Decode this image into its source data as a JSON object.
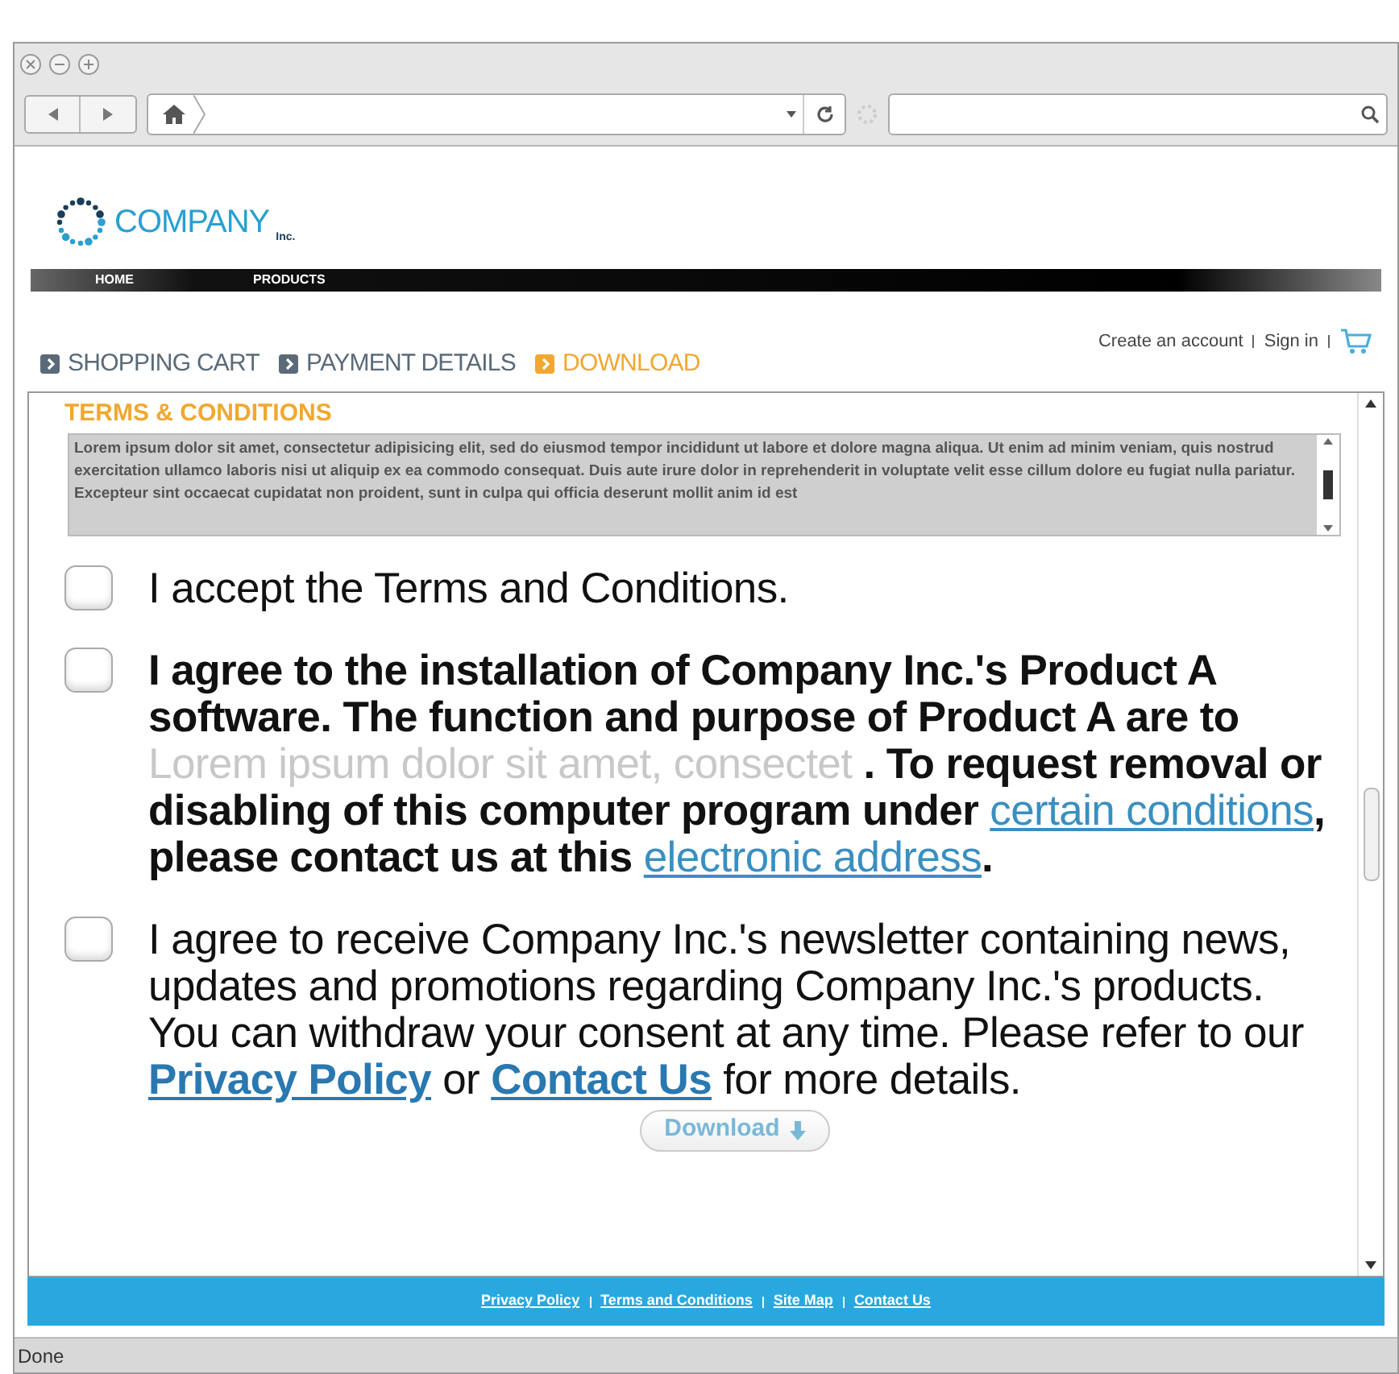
{
  "browser": {
    "status": "Done"
  },
  "site": {
    "logo": "COMPANY",
    "logo_suffix": "Inc.",
    "nav": [
      {
        "label": "HOME"
      },
      {
        "label": "PRODUCTS"
      }
    ],
    "steps": [
      {
        "label": "SHOPPING CART",
        "selected": false
      },
      {
        "label": "PAYMENT DETAILS",
        "selected": false
      },
      {
        "label": "DOWNLOAD",
        "selected": true
      }
    ],
    "account_links": [
      "Create an account",
      "Sign in"
    ]
  },
  "terms": {
    "title": "TERMS & CONDITIONS",
    "text": "Lorem ipsum dolor sit amet, consectetur adipisicing elit, sed do eiusmod tempor incididunt ut labore et dolore magna aliqua. Ut enim ad minim veniam, quis nostrud exercitation ullamco laboris nisi ut aliquip ex ea commodo consequat. Duis aute irure dolor in reprehenderit in voluptate velit esse cillum dolore eu fugiat nulla pariatur. Excepteur sint occaecat cupidatat non proident, sunt in culpa qui officia deserunt mollit anim id est"
  },
  "consents": [
    {
      "checked": false,
      "bold": false,
      "parts": [
        {
          "kind": "text",
          "text": "I accept the Terms and Conditions."
        }
      ]
    },
    {
      "checked": false,
      "bold": true,
      "parts": [
        {
          "kind": "text",
          "text": "I agree to the installation of Company Inc.'s Product A software. The function and purpose of Product A are to "
        },
        {
          "kind": "blurred",
          "text": "Lorem ipsum dolor sit amet, consectet"
        },
        {
          "kind": "text",
          "text": " . To request removal or disabling of this computer program under "
        },
        {
          "kind": "link",
          "text": "certain conditions"
        },
        {
          "kind": "text",
          "text": ", please contact us at this "
        },
        {
          "kind": "link",
          "text": "electronic address"
        },
        {
          "kind": "text",
          "text": "."
        }
      ]
    },
    {
      "checked": false,
      "bold": false,
      "parts": [
        {
          "kind": "text",
          "text": "I agree to receive Company Inc.'s newsletter containing news, updates and promotions regarding Company Inc.'s products. You can withdraw your consent at any time. Please refer to our "
        },
        {
          "kind": "strong-link",
          "text": "Privacy Policy"
        },
        {
          "kind": "text",
          "text": " or "
        },
        {
          "kind": "strong-link",
          "text": "Contact Us"
        },
        {
          "kind": "text",
          "text": " for more details."
        }
      ]
    }
  ],
  "download_button": "Download",
  "footer_links": [
    "Privacy Policy",
    "Terms and Conditions",
    "Site Map",
    "Contact Us"
  ]
}
